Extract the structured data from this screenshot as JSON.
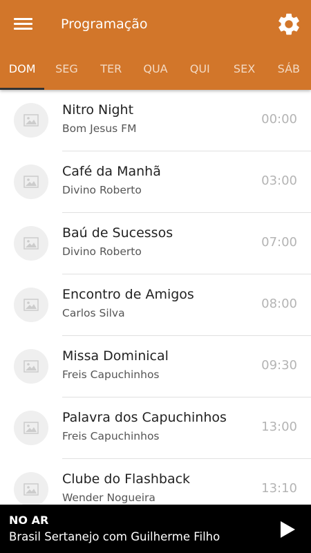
{
  "header": {
    "title": "Programação",
    "menu_icon": "hamburger-menu-icon",
    "settings_icon": "gear-icon",
    "background_color": "#d2762a"
  },
  "tabs": [
    {
      "label": "DOM",
      "active": true
    },
    {
      "label": "SEG",
      "active": false
    },
    {
      "label": "TER",
      "active": false
    },
    {
      "label": "QUA",
      "active": false
    },
    {
      "label": "QUI",
      "active": false
    },
    {
      "label": "SEX",
      "active": false
    },
    {
      "label": "SÁB",
      "active": false
    }
  ],
  "schedule": [
    {
      "title": "Nitro Night",
      "host": "Bom Jesus FM",
      "time": "00:00",
      "icon": "image-placeholder-icon"
    },
    {
      "title": "Café da Manhã",
      "host": "Divino Roberto",
      "time": "03:00",
      "icon": "image-placeholder-icon"
    },
    {
      "title": "Baú de Sucessos",
      "host": "Divino Roberto",
      "time": "07:00",
      "icon": "image-placeholder-icon"
    },
    {
      "title": "Encontro de Amigos",
      "host": "Carlos Silva",
      "time": "08:00",
      "icon": "image-placeholder-icon"
    },
    {
      "title": "Missa Dominical",
      "host": "Freis Capuchinhos",
      "time": "09:30",
      "icon": "image-placeholder-icon"
    },
    {
      "title": "Palavra dos Capuchinhos",
      "host": "Freis Capuchinhos",
      "time": "13:00",
      "icon": "image-placeholder-icon"
    },
    {
      "title": "Clube do Flashback",
      "host": "Wender Nogueira",
      "time": "13:10",
      "icon": "image-placeholder-icon"
    }
  ],
  "player": {
    "label": "NO AR",
    "now_playing": "Brasil Sertanejo com Guilherme Filho",
    "play_icon": "play-icon"
  }
}
